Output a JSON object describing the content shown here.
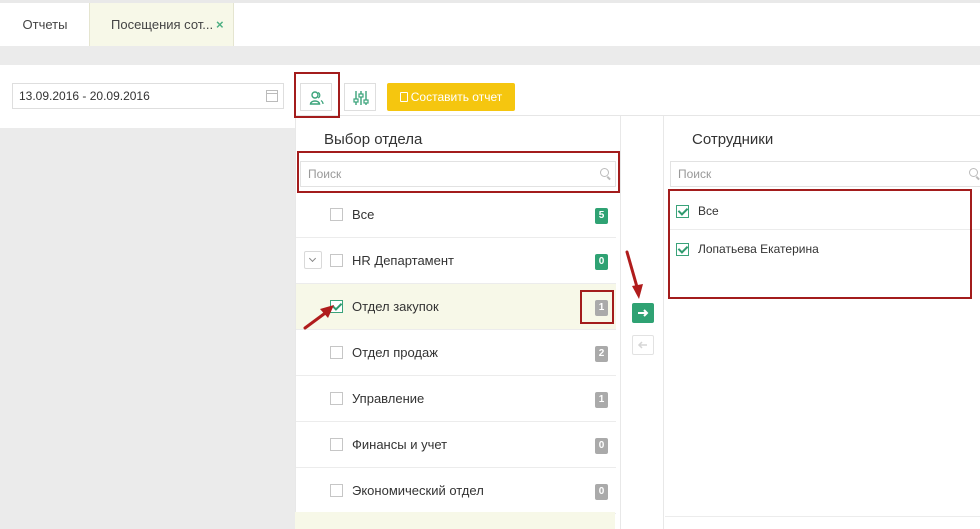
{
  "tabs": [
    {
      "label": "Отчеты"
    },
    {
      "label": "Посещения сот...",
      "close": "×"
    }
  ],
  "toolbar": {
    "date_range": "13.09.2016 - 20.09.2016",
    "report_button": "Составить отчет"
  },
  "departments": {
    "title": "Выбор отдела",
    "search_placeholder": "Поиск",
    "items": [
      {
        "label": "Все",
        "count": "5",
        "checked": false,
        "badge_color": "#2fa273"
      },
      {
        "label": "HR Департамент",
        "count": "0",
        "checked": false,
        "badge_color": "#2fa273"
      },
      {
        "label": "Отдел закупок",
        "count": "1",
        "checked": true,
        "badge_color": "#aaaaaa"
      },
      {
        "label": "Отдел продаж",
        "count": "2",
        "checked": false,
        "badge_color": "#aaaaaa"
      },
      {
        "label": "Управление",
        "count": "1",
        "checked": false,
        "badge_color": "#aaaaaa"
      },
      {
        "label": "Финансы и учет",
        "count": "0",
        "checked": false,
        "badge_color": "#aaaaaa"
      },
      {
        "label": "Экономический отдел",
        "count": "0",
        "checked": false,
        "badge_color": "#aaaaaa"
      }
    ]
  },
  "employees": {
    "title": "Сотрудники",
    "search_placeholder": "Поиск",
    "items": [
      {
        "label": "Все",
        "checked": true
      },
      {
        "label": "Лопатьева Екатерина",
        "checked": true
      }
    ]
  },
  "colors": {
    "accent_green": "#2fa273",
    "report_yellow": "#f5c60f",
    "highlight_red": "#a31c1c",
    "selected_row": "#f7f8e8"
  }
}
